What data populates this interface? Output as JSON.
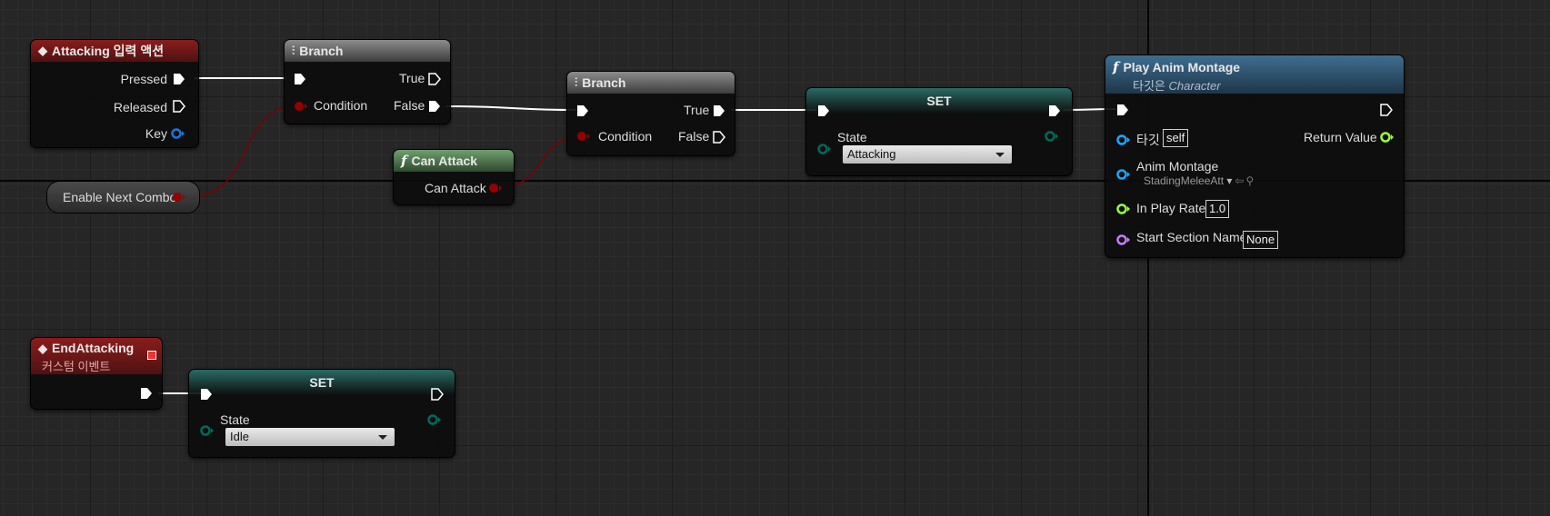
{
  "nodes": {
    "attacking_event": {
      "title": "Attacking 입력 액션",
      "pressed": "Pressed",
      "released": "Released",
      "key": "Key"
    },
    "branch1": {
      "title": "Branch",
      "condition": "Condition",
      "true": "True",
      "false": "False"
    },
    "enable_next_combo": {
      "label": "Enable Next Combo"
    },
    "can_attack": {
      "title": "Can Attack",
      "output": "Can Attack"
    },
    "branch2": {
      "title": "Branch",
      "condition": "Condition",
      "true": "True",
      "false": "False"
    },
    "set_attacking": {
      "title": "SET",
      "var_label": "State",
      "value": "Attacking"
    },
    "play_anim_montage": {
      "title": "Play Anim Montage",
      "subtitle_prefix": "타깃은",
      "subtitle_target": "Character",
      "target_label": "타깃",
      "target_value": "self",
      "return_label": "Return Value",
      "anim_montage_label": "Anim Montage",
      "anim_montage_value": "StadingMeleeAtt",
      "play_rate_label": "In Play Rate",
      "play_rate_value": "1.0",
      "start_section_label": "Start Section Name",
      "start_section_value": "None"
    },
    "end_attacking_event": {
      "title": "EndAttacking",
      "subtitle": "커스텀 이벤트"
    },
    "set_idle": {
      "title": "SET",
      "var_label": "State",
      "value": "Idle"
    }
  },
  "colors": {
    "exec": "#ffffff",
    "bool": "#950000",
    "object": "#18a7ff",
    "enum": "#00695a",
    "float": "#98fd3a",
    "name": "#c27ff8"
  },
  "icons": {
    "event": "diamond-event-icon",
    "branch": "branch-icon",
    "function": "function-icon"
  }
}
